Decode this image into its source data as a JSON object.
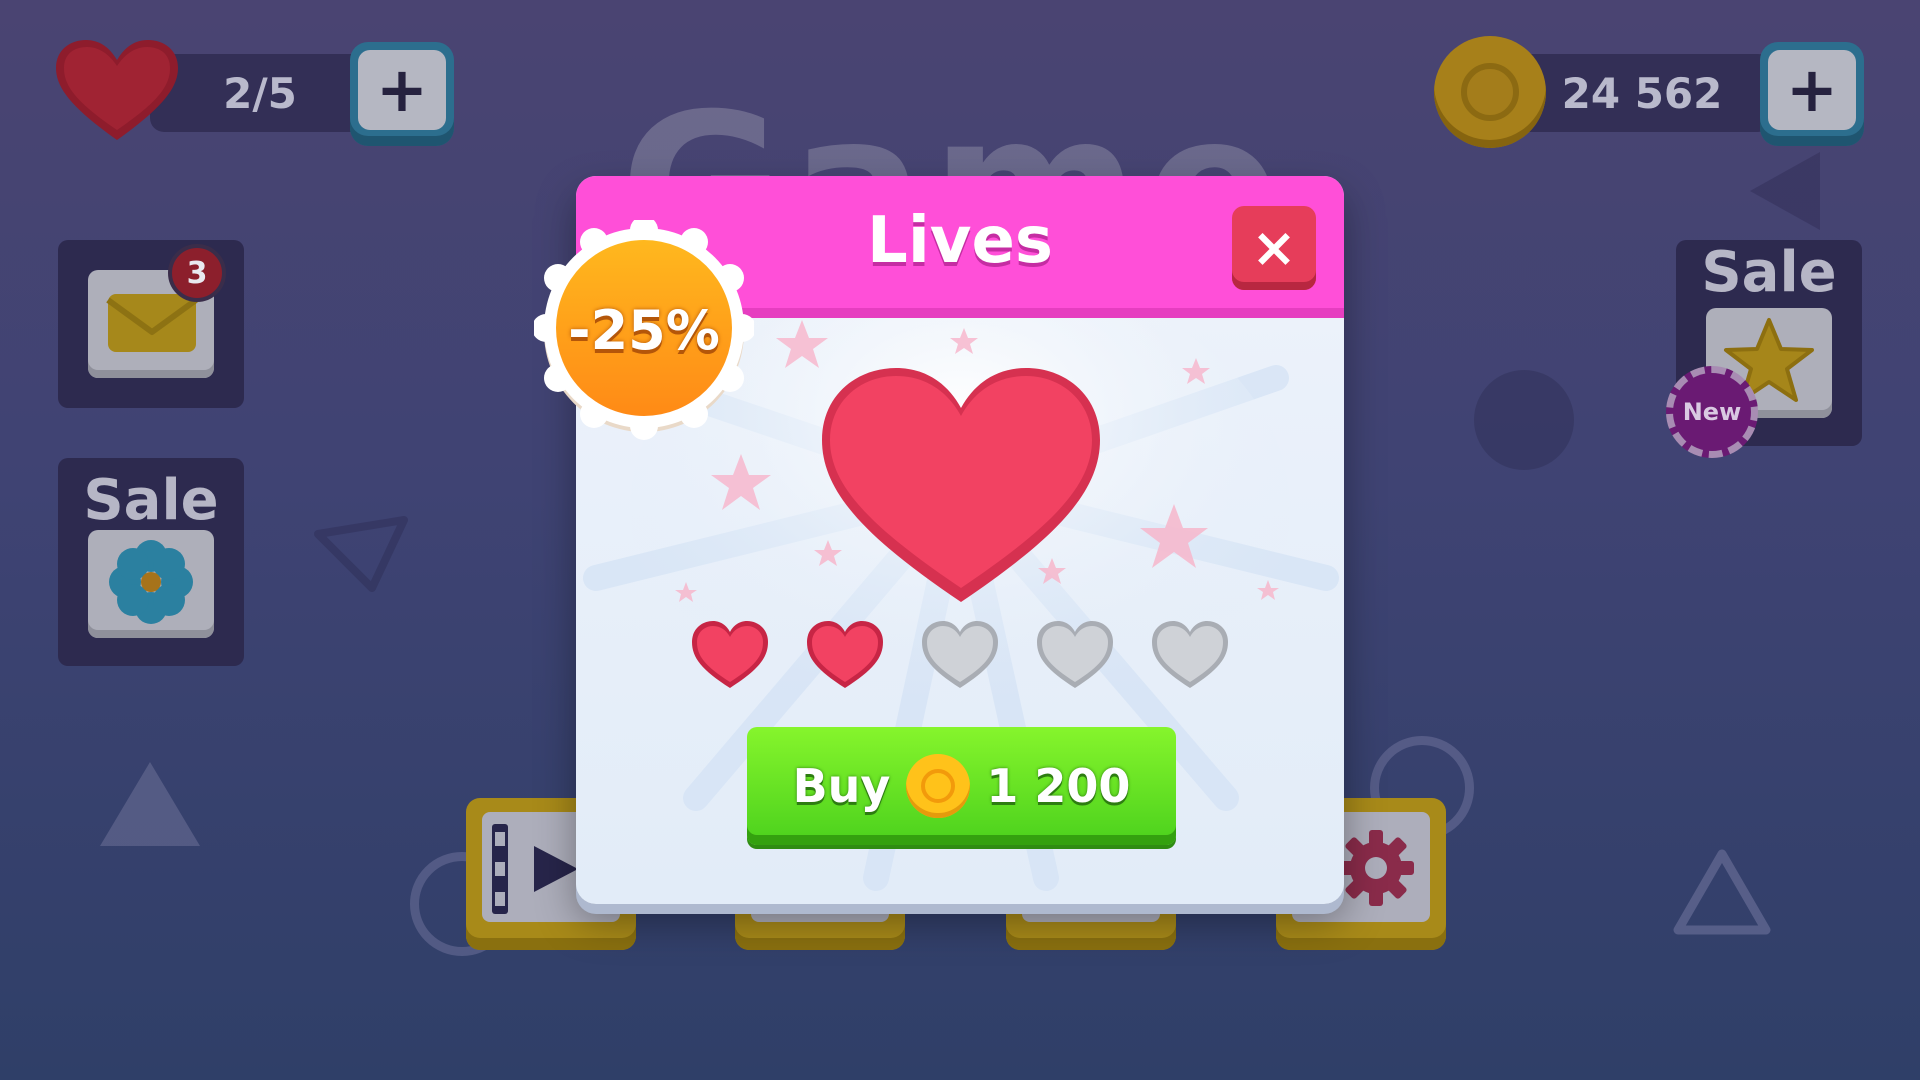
{
  "hud": {
    "lives_value": "2/5",
    "coins_value": "24 562",
    "lives_plus_label": "+",
    "coins_plus_label": "+"
  },
  "background_title": "Game",
  "left_menu": {
    "mail_badge_count": "3",
    "sale_label": "Sale"
  },
  "right_menu": {
    "sale_label": "Sale",
    "new_badge": "New"
  },
  "popup": {
    "title": "Lives",
    "close_label": "×",
    "discount_label": "-25%",
    "lives_filled": 2,
    "lives_total": 5,
    "buy_label": "Buy",
    "price": "1 200"
  },
  "colors": {
    "header_pink": "#ff4fd8",
    "heart_red": "#f24262",
    "buy_green": "#5fe01f",
    "discount_orange": "#ff9c1a"
  }
}
